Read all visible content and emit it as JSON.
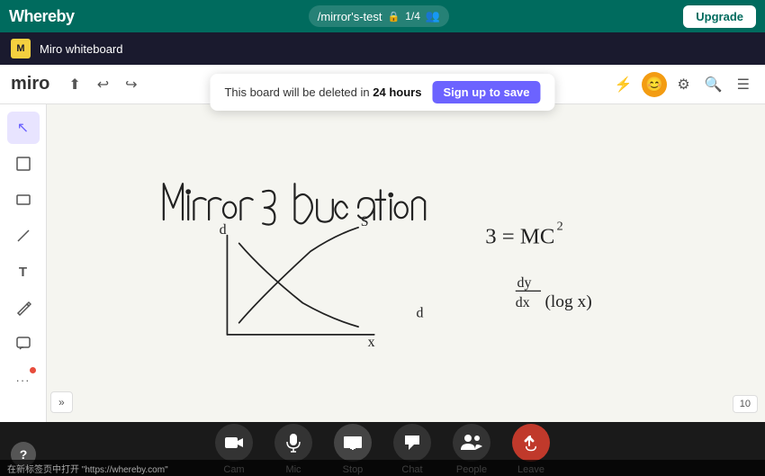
{
  "whereby_bar": {
    "logo": "Whereby",
    "room": "/mirror's-test",
    "lock_icon": "🔒",
    "participant_count": "1/4",
    "people_icon": "👥",
    "upgrade_label": "Upgrade"
  },
  "miro_bar": {
    "logo_text": "M",
    "title": "Miro whiteboard"
  },
  "miro_toolbar": {
    "wordmark": "miro",
    "upload_icon": "⬆",
    "undo_icon": "↩",
    "redo_icon": "↪"
  },
  "board_notice": {
    "text": "This board will be deleted in",
    "highlight": "24 hours",
    "cta_label": "Sign up to save"
  },
  "toolbar_right": {
    "filter_icon": "⚡",
    "search_icon": "🔍",
    "menu_icon": "☰"
  },
  "left_tools": [
    {
      "name": "select",
      "icon": "↖",
      "active": true
    },
    {
      "name": "frame",
      "icon": "⬜"
    },
    {
      "name": "rectangle",
      "icon": "▭"
    },
    {
      "name": "line",
      "icon": "╱"
    },
    {
      "name": "text",
      "icon": "T"
    },
    {
      "name": "pen",
      "icon": "✏"
    },
    {
      "name": "comment",
      "icon": "💬"
    },
    {
      "name": "more",
      "icon": "···",
      "has_dot": true
    }
  ],
  "canvas": {
    "expand_label": "»",
    "zoom_level": "10"
  },
  "bottom_controls": [
    {
      "name": "cam",
      "icon": "📷",
      "label": "Cam"
    },
    {
      "name": "mic",
      "icon": "🎤",
      "label": "Mic"
    },
    {
      "name": "stop",
      "icon": "🖥",
      "label": "Stop"
    },
    {
      "name": "chat",
      "icon": "💬",
      "label": "Chat"
    },
    {
      "name": "people",
      "icon": "👥",
      "label": "People"
    },
    {
      "name": "leave",
      "icon": "✋",
      "label": "Leave"
    }
  ],
  "help": {
    "label": "?"
  },
  "status_bar": {
    "text": "在新标签页中打开 \"https://whereby.com\""
  }
}
